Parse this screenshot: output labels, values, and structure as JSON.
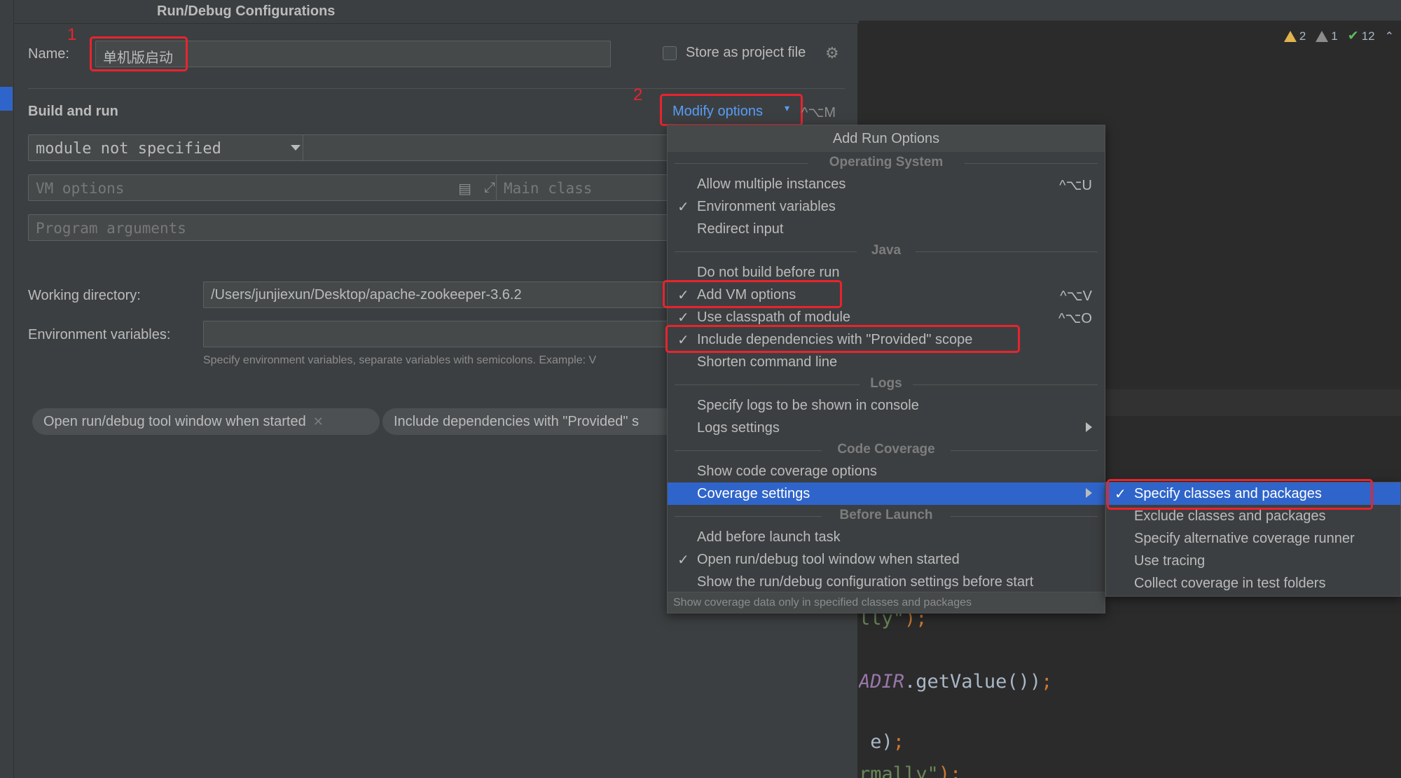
{
  "dialog": {
    "title": "Run/Debug Configurations",
    "name_label": "Name:",
    "name_value": "单机版启动",
    "store_label": "Store as project file",
    "build_run_label": "Build and run",
    "modify_options_label": "Modify options",
    "modify_options_shortcut": "^⌥M",
    "module_value": "module not specified",
    "vm_options_placeholder": "VM options",
    "main_class_placeholder": "Main class",
    "program_args_placeholder": "Program arguments",
    "working_dir_label": "Working directory:",
    "working_dir_value": "/Users/junjiexun/Desktop/apache-zookeeper-3.6.2",
    "env_vars_label": "Environment variables:",
    "env_vars_hint": "Specify environment variables, separate variables with semicolons. Example: V",
    "chips": [
      "Open run/debug tool window when started",
      "Include dependencies with \"Provided\" s"
    ]
  },
  "annotations": {
    "marker1": "1",
    "marker2": "2"
  },
  "menu": {
    "title": "Add Run Options",
    "sections": {
      "os": "Operating System",
      "java": "Java",
      "logs": "Logs",
      "coverage": "Code Coverage",
      "before_launch": "Before Launch"
    },
    "items": [
      {
        "label": "Allow multiple instances",
        "checked": false,
        "shortcut": "^⌥U"
      },
      {
        "label": "Environment variables",
        "checked": true,
        "shortcut": ""
      },
      {
        "label": "Redirect input",
        "checked": false,
        "shortcut": ""
      },
      {
        "label": "Do not build before run",
        "checked": false,
        "shortcut": ""
      },
      {
        "label": "Add VM options",
        "checked": true,
        "shortcut": "^⌥V"
      },
      {
        "label": "Use classpath of module",
        "checked": true,
        "shortcut": "^⌥O"
      },
      {
        "label": "Include dependencies with \"Provided\" scope",
        "checked": true,
        "shortcut": ""
      },
      {
        "label": "Shorten command line",
        "checked": false,
        "shortcut": ""
      },
      {
        "label": "Specify logs to be shown in console",
        "checked": false,
        "shortcut": ""
      },
      {
        "label": "Logs settings",
        "checked": false,
        "shortcut": ""
      },
      {
        "label": "Show code coverage options",
        "checked": false,
        "shortcut": ""
      },
      {
        "label": "Coverage settings",
        "checked": false,
        "shortcut": ""
      },
      {
        "label": "Add before launch task",
        "checked": false,
        "shortcut": ""
      },
      {
        "label": "Open run/debug tool window when started",
        "checked": true,
        "shortcut": ""
      },
      {
        "label": "Show the run/debug configuration settings before start",
        "checked": false,
        "shortcut": ""
      }
    ],
    "footer": "Show coverage data only in specified classes and packages",
    "check_glyph": "✓"
  },
  "submenu": {
    "items": [
      {
        "label": "Specify classes and packages",
        "checked": true
      },
      {
        "label": "Exclude classes and packages",
        "checked": false
      },
      {
        "label": "Specify alternative coverage runner",
        "checked": false
      },
      {
        "label": "Use tracing",
        "checked": false
      },
      {
        "label": "Collect coverage in test folders",
        "checked": false
      }
    ]
  },
  "editor": {
    "warnings": "2",
    "weak_warnings": "1",
    "ok_count": "12",
    "code": {
      "line1_text": "lly\"",
      "line1_end": ");",
      "line2_const": "ADIR",
      "line2_rest": ".getValue())",
      "line2_end": ";",
      "line3_text": " e)",
      "line3_end": ";",
      "line4_text": "rmally\"",
      "line4_end": ");"
    }
  },
  "colors": {
    "accent": "#2f65ca",
    "annotation_red": "#e8242e",
    "link_blue": "#589df6"
  }
}
